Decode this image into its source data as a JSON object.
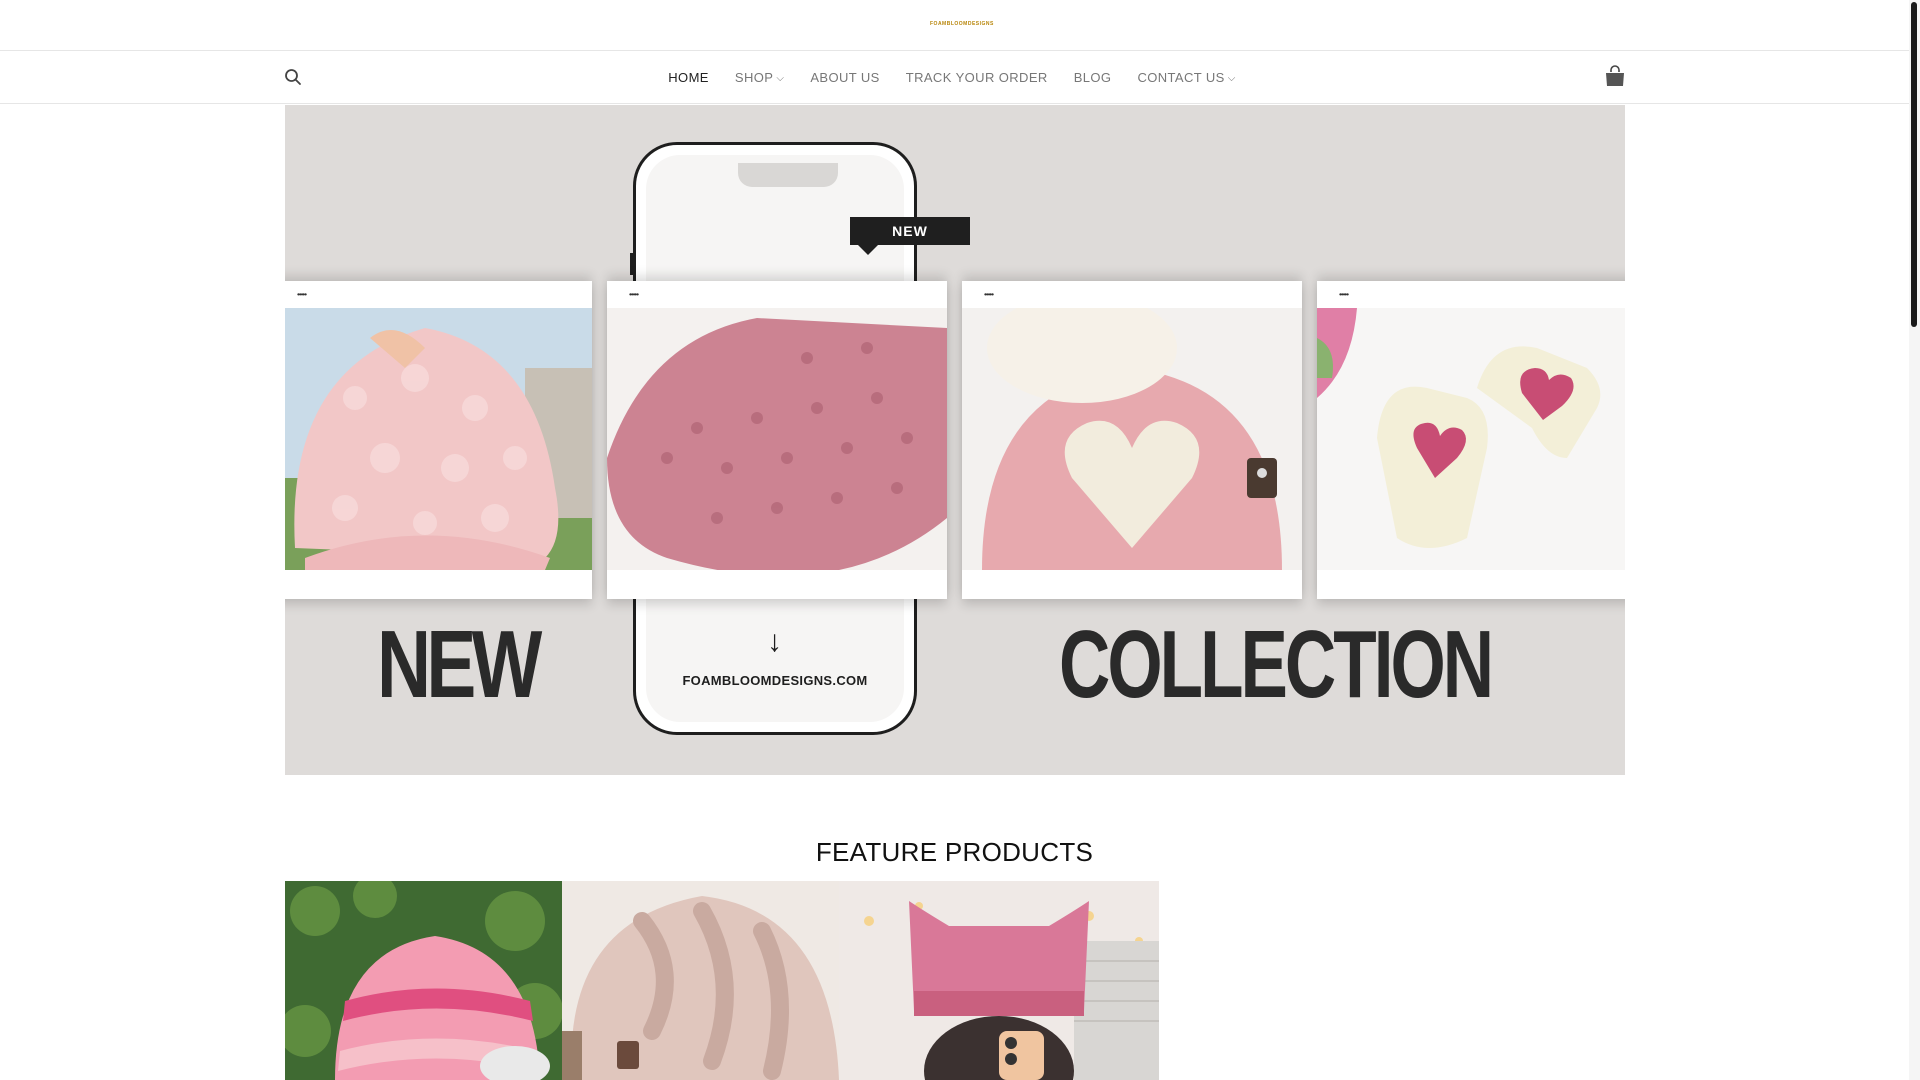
{
  "header": {
    "logo_text": "FOAMBLOOMDESIGNS"
  },
  "nav": {
    "items": [
      {
        "label": "HOME",
        "active": true,
        "dropdown": false
      },
      {
        "label": "SHOP",
        "active": false,
        "dropdown": true
      },
      {
        "label": "ABOUT US",
        "active": false,
        "dropdown": false
      },
      {
        "label": "TRACK YOUR ORDER",
        "active": false,
        "dropdown": false
      },
      {
        "label": "BLOG",
        "active": false,
        "dropdown": false
      },
      {
        "label": "CONTACT US",
        "active": false,
        "dropdown": true
      }
    ],
    "search_icon": "search-icon",
    "cart_icon": "shopping-bag-icon"
  },
  "banner": {
    "badge": "NEW",
    "url": "FOAMBLOOMDESIGNS.COM",
    "headline_left": "NEW",
    "headline_right": "COLLECTION",
    "background_color": "#dedbd9"
  },
  "section": {
    "title": "FEATURE PRODUCTS"
  },
  "colors": {
    "accent_pink": "#e9a7b5",
    "text_dark": "#222222",
    "nav_gray": "#777777"
  }
}
